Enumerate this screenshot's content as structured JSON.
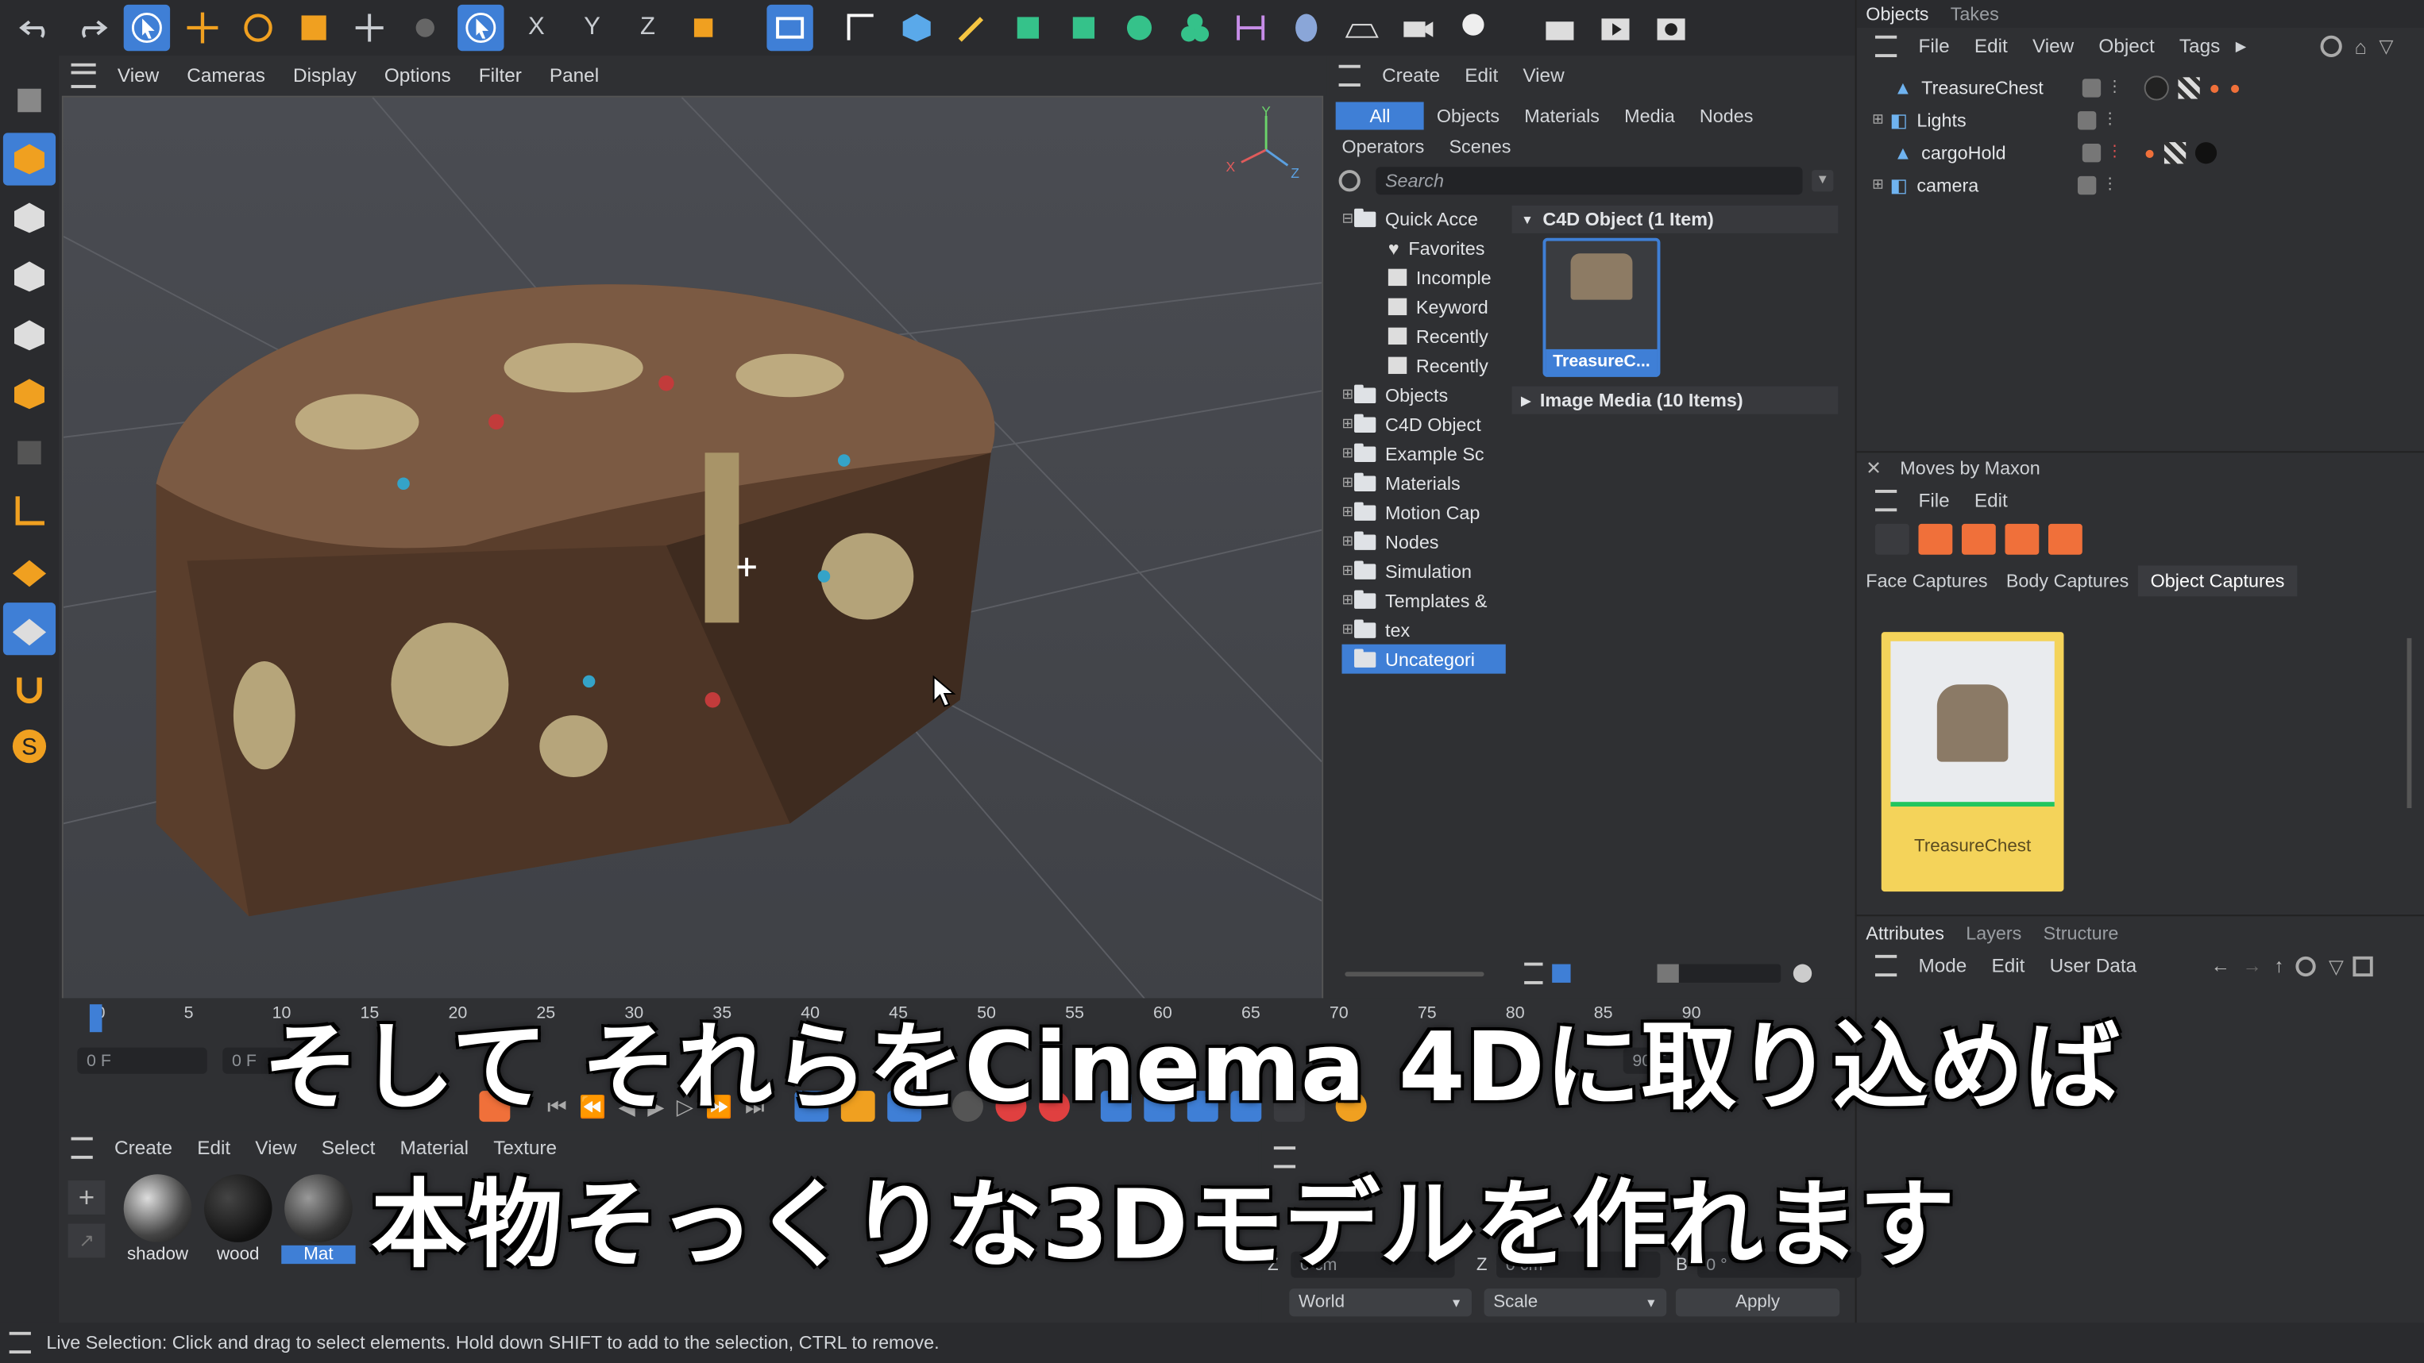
{
  "toolbar": {
    "icons": [
      "undo-icon",
      "redo-icon",
      "select-icon",
      "move-icon",
      "rotate-icon",
      "scale-icon",
      "transform-icon",
      "placeholder-icon",
      "live-select-icon",
      "x-axis-icon",
      "y-axis-icon",
      "z-axis-icon",
      "coordinate-icon",
      "render-view-icon",
      "spline-icon",
      "cube-icon",
      "pen-icon",
      "generator-icon",
      "deformer-icon",
      "field-icon",
      "mograph-icon",
      "symmetry-icon",
      "sky-icon",
      "floor-icon",
      "camera-icon",
      "light-icon",
      "clapper-icon",
      "render-icon",
      "render-settings-icon"
    ]
  },
  "viewport_menu": {
    "items": [
      "View",
      "Cameras",
      "Display",
      "Options",
      "Filter",
      "Panel"
    ]
  },
  "asset_browser": {
    "menu": [
      "Create",
      "Edit",
      "View"
    ],
    "filter_tabs": [
      "All",
      "Objects",
      "Materials",
      "Media",
      "Nodes"
    ],
    "filter_tabs2": [
      "Operators",
      "Scenes"
    ],
    "search_placeholder": "Search",
    "tree": [
      "Quick Acce",
      "Favorites",
      "Incomple",
      "Keyword",
      "Recently",
      "Recently",
      "Objects",
      "C4D Object",
      "Example Sc",
      "Materials",
      "Motion Cap",
      "Nodes",
      "Simulation",
      "Templates &",
      "tex",
      "Uncategori"
    ],
    "group1": "C4D Object (1 Item)",
    "thumb_label": "TreasureC...",
    "group2": "Image Media (10 Items)"
  },
  "objects_panel": {
    "tabs": [
      "Objects",
      "Takes"
    ],
    "menu": [
      "File",
      "Edit",
      "View",
      "Object",
      "Tags"
    ],
    "objects": [
      "TreasureChest",
      "Lights",
      "cargoHold",
      "camera"
    ]
  },
  "moves_panel": {
    "title": "Moves by Maxon",
    "menu": [
      "File",
      "Edit"
    ],
    "tabs": [
      "Face Captures",
      "Body Captures",
      "Object Captures"
    ],
    "card_label": "TreasureChest"
  },
  "attributes_panel": {
    "tabs": [
      "Attributes",
      "Layers",
      "Structure"
    ],
    "menu": [
      "Mode",
      "Edit",
      "User Data"
    ]
  },
  "timeline": {
    "ruler": [
      "0",
      "5",
      "10",
      "15",
      "20",
      "25",
      "30",
      "35",
      "40",
      "45",
      "50",
      "55",
      "60",
      "65",
      "70",
      "75",
      "80",
      "85",
      "90"
    ],
    "current_frame": "0 F",
    "start_frame": "0 F",
    "end_frame": "90 F"
  },
  "material_manager": {
    "menu": [
      "Create",
      "Edit",
      "View",
      "Select",
      "Material",
      "Texture"
    ],
    "materials": [
      "shadow",
      "wood",
      "Mat"
    ]
  },
  "coords": {
    "z_label": "Z",
    "z_pos": "0 cm",
    "z_size": "0 cm",
    "b_label": "B",
    "b_val": "0 °",
    "world": "World",
    "scale": "Scale",
    "apply": "Apply"
  },
  "status_bar": "Live Selection: Click and drag to select elements. Hold down SHIFT to add to the selection, CTRL to remove.",
  "subtitles": {
    "line1": "そして それらをCinema 4Dに取り込めば",
    "line2": "本物そっくりな3Dモデルを作れます"
  },
  "colors": {
    "accent_blue": "#3f7fd6",
    "card_yellow": "#f4d35a",
    "thumb_green": "#22c55e"
  }
}
